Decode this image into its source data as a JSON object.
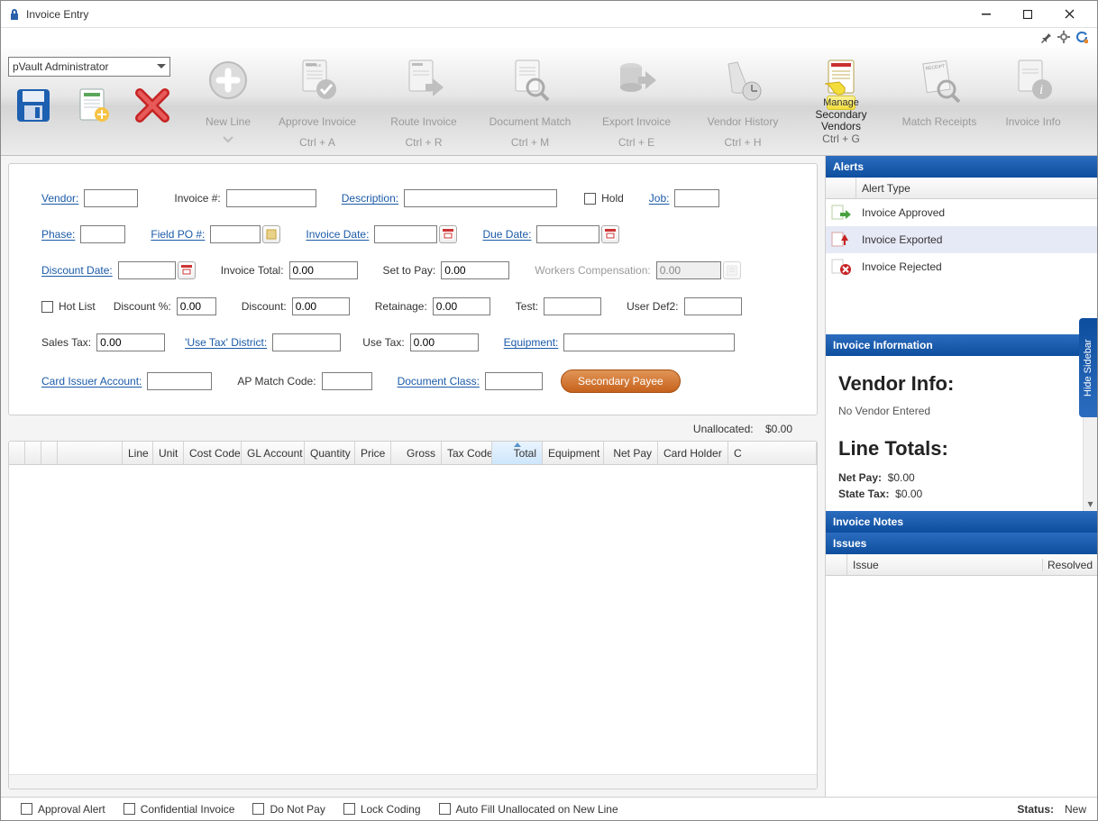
{
  "window": {
    "title": "Invoice Entry"
  },
  "admin": {
    "selected": "pVault Administrator"
  },
  "ribbon": {
    "tools": [
      {
        "cap": "New Line",
        "short": ""
      },
      {
        "cap": "Approve Invoice",
        "short": "Ctrl + A"
      },
      {
        "cap": "Route Invoice",
        "short": "Ctrl + R"
      },
      {
        "cap": "Document Match",
        "short": "Ctrl + M"
      },
      {
        "cap": "Export Invoice",
        "short": "Ctrl + E"
      },
      {
        "cap": "Vendor History",
        "short": "Ctrl + H"
      },
      {
        "cap": "Manage Secondary Vendors",
        "short": "Ctrl + G"
      },
      {
        "cap": "Match Receipts",
        "short": ""
      },
      {
        "cap": "Invoice Info",
        "short": ""
      }
    ]
  },
  "form": {
    "vendor_l": "Vendor:",
    "invoice_no_l": "Invoice #:",
    "description_l": "Description:",
    "hold_l": "Hold",
    "job_l": "Job:",
    "phase_l": "Phase:",
    "field_po_l": "Field PO #:",
    "invoice_date_l": "Invoice Date:",
    "due_date_l": "Due Date:",
    "disc_date_l": "Discount Date:",
    "inv_total_l": "Invoice Total:",
    "inv_total_v": "0.00",
    "set_pay_l": "Set to Pay:",
    "set_pay_v": "0.00",
    "wc_l": "Workers Compensation:",
    "wc_v": "0.00",
    "hotlist_l": "Hot List",
    "disc_pct_l": "Discount %:",
    "disc_pct_v": "0.00",
    "discount_l": "Discount:",
    "discount_v": "0.00",
    "retainage_l": "Retainage:",
    "retainage_v": "0.00",
    "test_l": "Test:",
    "userdef2_l": "User Def2:",
    "sales_tax_l": "Sales Tax:",
    "sales_tax_v": "0.00",
    "use_tax_dist_l": "'Use Tax' District:",
    "use_tax_l": "Use Tax:",
    "use_tax_v": "0.00",
    "equipment_l": "Equipment:",
    "card_issuer_l": "Card Issuer Account:",
    "ap_match_l": "AP Match Code:",
    "doc_class_l": "Document Class:",
    "sec_payee_btn": "Secondary Payee"
  },
  "unallocated": {
    "label": "Unallocated:",
    "value": "$0.00"
  },
  "grid": {
    "cols": [
      "",
      "",
      "",
      "",
      "Line",
      "Unit",
      "Cost Code",
      "GL Account",
      "Quantity",
      "Price",
      "Gross",
      "Tax Code",
      "Total",
      "Equipment",
      "Net Pay",
      "Card Holder",
      "C"
    ]
  },
  "sidebar": {
    "alerts_h": "Alerts",
    "alert_type_h": "Alert Type",
    "alerts": [
      "Invoice Approved",
      "Invoice Exported",
      "Invoice Rejected"
    ],
    "invinfo_h": "Invoice Information",
    "vendor_info_h": "Vendor Info:",
    "vendor_info_sub": "No Vendor Entered",
    "line_totals_h": "Line Totals:",
    "netpay_l": "Net Pay:",
    "netpay_v": "$0.00",
    "statetax_l": "State Tax:",
    "statetax_v": "$0.00",
    "notes_h": "Invoice Notes",
    "issues_h": "Issues",
    "issues_col1": "Issue",
    "issues_col2": "Resolved",
    "hide_tab": "Hide Sidebar"
  },
  "status": {
    "opts": [
      "Approval Alert",
      "Confidential Invoice",
      "Do Not Pay",
      "Lock Coding",
      "Auto Fill Unallocated on New Line"
    ],
    "status_l": "Status:",
    "status_v": "New"
  }
}
